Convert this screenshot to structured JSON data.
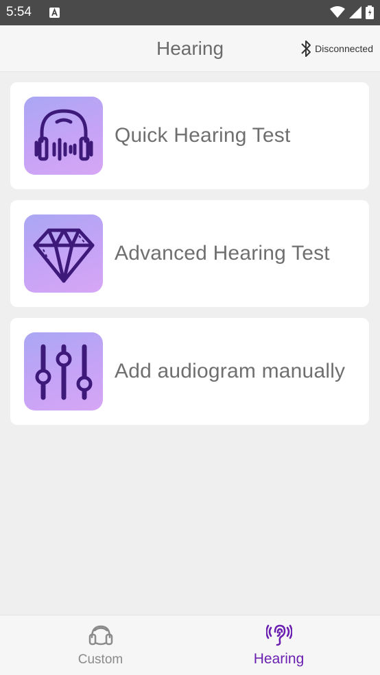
{
  "status_bar": {
    "time": "5:54"
  },
  "app_bar": {
    "title": "Hearing",
    "bluetooth_status": "Disconnected"
  },
  "cards": [
    {
      "label": "Quick Hearing Test",
      "icon": "headphones-icon"
    },
    {
      "label": "Advanced Hearing Test",
      "icon": "diamond-icon"
    },
    {
      "label": "Add audiogram manually",
      "icon": "equalizer-icon"
    }
  ],
  "bottom_nav": {
    "tabs": [
      {
        "label": "Custom",
        "icon": "headset-icon",
        "active": false
      },
      {
        "label": "Hearing",
        "icon": "ear-icon",
        "active": true
      }
    ]
  },
  "colors": {
    "accent": "#6a1fb0",
    "icon_stroke": "#3d1a7a",
    "icon_gradient_start": "#a9a7f3",
    "icon_gradient_end": "#d6a6f5"
  }
}
